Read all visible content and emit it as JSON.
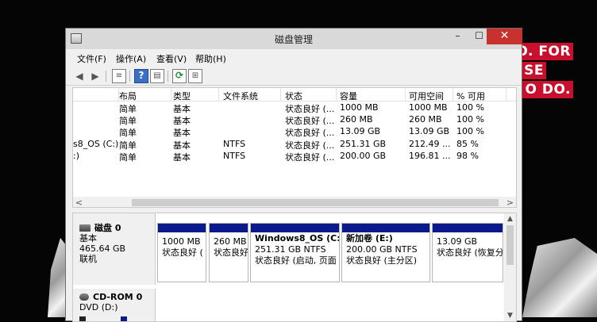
{
  "window": {
    "title": "磁盘管理",
    "min_glyph": "–",
    "max_glyph": "☐",
    "close_glyph": "✕"
  },
  "background": {
    "texts": [
      "O. FOR",
      "SE",
      "O DO."
    ]
  },
  "menu": [
    "文件(F)",
    "操作(A)",
    "查看(V)",
    "帮助(H)"
  ],
  "toolbar": {
    "back_glyph": "◀",
    "forward_glyph": "▶",
    "list_glyph": "≡",
    "help_glyph": "?",
    "props_glyph": "▤",
    "refresh_glyph": "⟳",
    "rescan_glyph": "⊞"
  },
  "volume_list": {
    "columns": [
      "布局",
      "类型",
      "文件系统",
      "状态",
      "容量",
      "可用空间",
      "% 可用"
    ],
    "rows": [
      {
        "volume": "",
        "layout": "简单",
        "type": "基本",
        "fs": "",
        "status": "状态良好 (...",
        "capacity": "1000 MB",
        "free": "1000 MB",
        "pct": "100 %"
      },
      {
        "volume": "",
        "layout": "简单",
        "type": "基本",
        "fs": "",
        "status": "状态良好 (...",
        "capacity": "260 MB",
        "free": "260 MB",
        "pct": "100 %"
      },
      {
        "volume": "",
        "layout": "简单",
        "type": "基本",
        "fs": "",
        "status": "状态良好 (...",
        "capacity": "13.09 GB",
        "free": "13.09 GB",
        "pct": "100 %"
      },
      {
        "volume": "s8_OS (C:)",
        "layout": "简单",
        "type": "基本",
        "fs": "NTFS",
        "status": "状态良好 (...",
        "capacity": "251.31 GB",
        "free": "212.49 ...",
        "pct": "85 %"
      },
      {
        "volume": ":)",
        "layout": "简单",
        "type": "基本",
        "fs": "NTFS",
        "status": "状态良好 (...",
        "capacity": "200.00 GB",
        "free": "196.81 ...",
        "pct": "98 %"
      }
    ],
    "scroll_left": "<",
    "scroll_right": ">"
  },
  "disk_map": {
    "disk0": {
      "name": "磁盘 0",
      "type": "基本",
      "size": "465.64 GB",
      "status": "联机"
    },
    "partitions": [
      {
        "name": "",
        "size": "1000 MB",
        "status": "状态良好 ("
      },
      {
        "name": "",
        "size": "260 MB",
        "status": "状态良好"
      },
      {
        "name": "Windows8_OS  (C:)",
        "size": "251.31 GB NTFS",
        "status": "状态良好 (启动, 页面"
      },
      {
        "name": "新加卷  (E:)",
        "size": "200.00 GB NTFS",
        "status": "状态良好 (主分区)"
      },
      {
        "name": "",
        "size": "13.09 GB",
        "status": "状态良好 (恢复分"
      }
    ],
    "cdrom": {
      "name": "CD-ROM 0",
      "type": "DVD (D:)"
    },
    "scroll_up": "▲",
    "scroll_down": "▼"
  },
  "colors": {
    "partition_bar": "#0a1a8c",
    "close_button": "#c7322e",
    "bg_badge": "#c8102e"
  }
}
